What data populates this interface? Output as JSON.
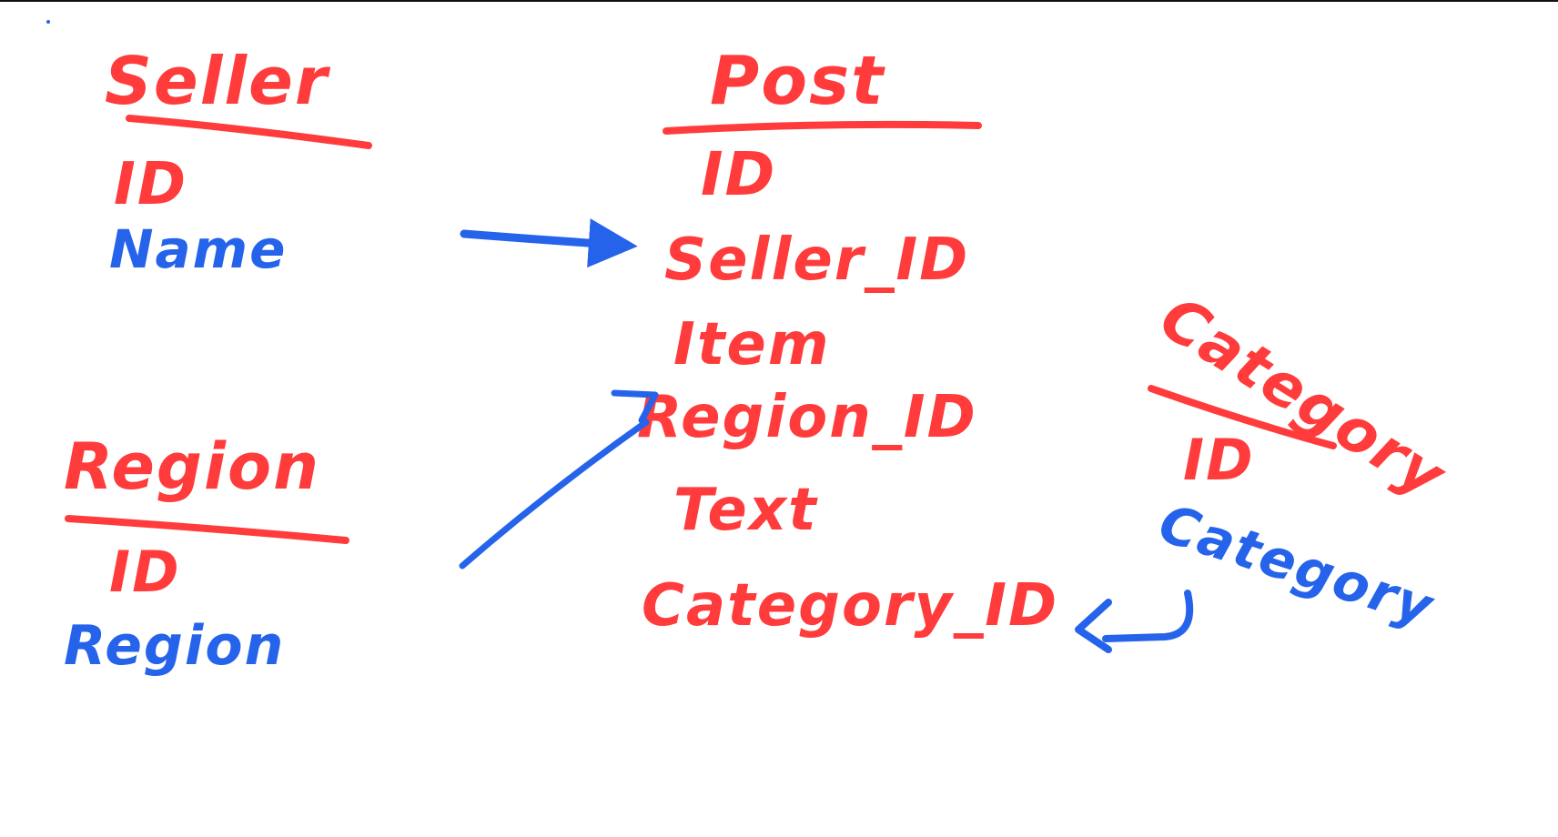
{
  "colors": {
    "red": "#ff3b3b",
    "blue": "#2563eb"
  },
  "entities": {
    "seller": {
      "title": "Seller",
      "fields": [
        {
          "text": "ID",
          "color": "red"
        },
        {
          "text": "Name",
          "color": "blue"
        }
      ]
    },
    "region": {
      "title": "Region",
      "fields": [
        {
          "text": "ID",
          "color": "red"
        },
        {
          "text": "Region",
          "color": "blue"
        }
      ]
    },
    "post": {
      "title": "Post",
      "fields": [
        {
          "text": "ID",
          "color": "red"
        },
        {
          "text": "Seller_ID",
          "color": "red"
        },
        {
          "text": "Item",
          "color": "red"
        },
        {
          "text": "Region_ID",
          "color": "red"
        },
        {
          "text": "Text",
          "color": "red"
        },
        {
          "text": "Category_ID",
          "color": "red"
        }
      ]
    },
    "category": {
      "title": "Category",
      "fields": [
        {
          "text": "ID",
          "color": "red"
        },
        {
          "text": "Category",
          "color": "blue"
        }
      ]
    }
  }
}
